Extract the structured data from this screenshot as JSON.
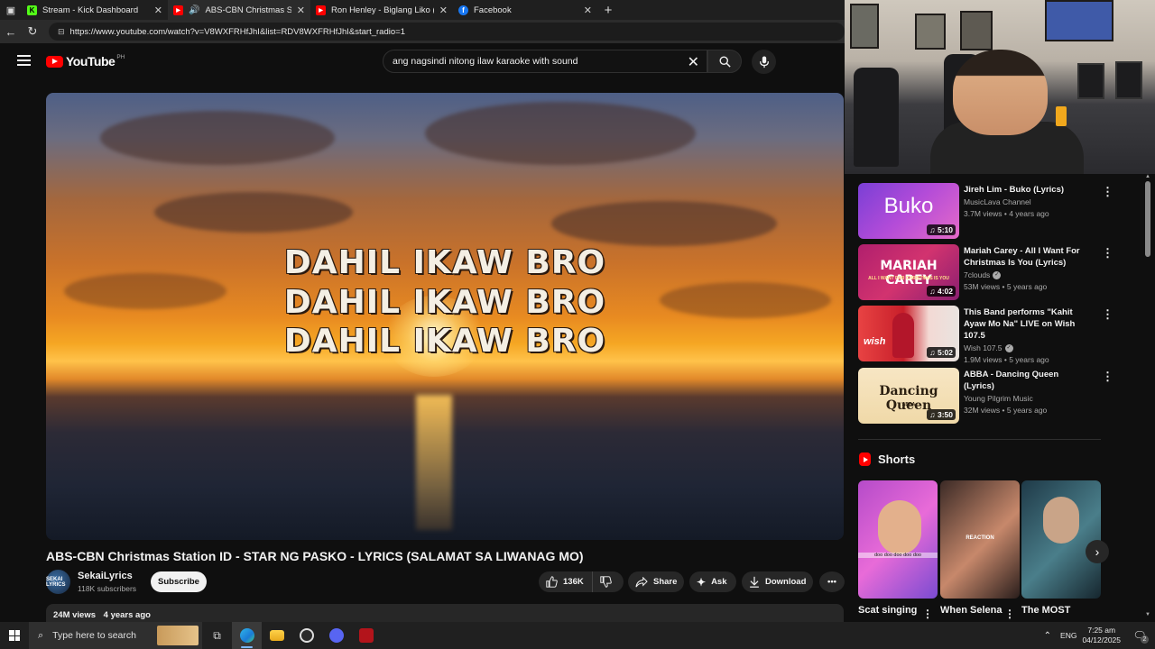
{
  "browser": {
    "tabs": [
      {
        "title": "Stream - Kick Dashboard",
        "favicon": "kick-icon",
        "color": "#53fc18"
      },
      {
        "title": "ABS-CBN Christmas Station I",
        "favicon": "youtube-icon",
        "color": "#ff0000",
        "audio": true
      },
      {
        "title": "Ron Henley - Biglang Liko (Lyrics)",
        "favicon": "youtube-icon",
        "color": "#ff0000"
      },
      {
        "title": "Facebook",
        "favicon": "facebook-icon",
        "color": "#1877f2"
      }
    ],
    "new_tab": "+",
    "url": "https://www.youtube.com/watch?v=V8WXFRHfJhI&list=RDV8WXFRHfJhI&start_radio=1"
  },
  "youtube": {
    "logo_text": "YouTube",
    "country_code": "PH",
    "search_query": "ang nagsindi nitong ilaw karaoke with sound"
  },
  "video": {
    "lyric_lines": [
      "DAHIL IKAW BRO",
      "DAHIL IKAW BRO",
      "DAHIL IKAW BRO"
    ],
    "title": "ABS-CBN Christmas Station ID - STAR NG PASKO - LYRICS (SALAMAT SA LIWANAG MO)",
    "channel": "SekaiLyrics",
    "subscribers": "118K subscribers",
    "avatar_text": "SEKAI LYRICS",
    "subscribe_label": "Subscribe",
    "likes": "136K",
    "share_label": "Share",
    "ask_label": "Ask",
    "download_label": "Download",
    "views": "24M views",
    "age": "4 years ago"
  },
  "related": [
    {
      "title": "Jireh Lim - Buko (Lyrics)",
      "channel": "MusicLava Channel",
      "views": "3.7M views",
      "age": "4 years ago",
      "duration": "5:10",
      "thumb_text": "Buko",
      "verified": false
    },
    {
      "title": "Mariah Carey - All I Want For Christmas Is You (Lyrics)",
      "channel": "7clouds",
      "views": "53M views",
      "age": "5 years ago",
      "duration": "4:02",
      "thumb_text": "MARIAH CAREY",
      "thumb_sub": "ALL I WANT FOR CHRISTMAS IS YOU",
      "verified": true
    },
    {
      "title": "This Band performs \"Kahit Ayaw Mo Na\" LIVE on Wish 107.5",
      "channel": "Wish 107.5",
      "views": "1.9M views",
      "age": "5 years ago",
      "duration": "5:02",
      "thumb_text": "wish",
      "verified": true
    },
    {
      "title": "ABBA - Dancing Queen (Lyrics)",
      "channel": "Young Pilgrim Music",
      "views": "32M views",
      "age": "5 years ago",
      "duration": "3:50",
      "thumb_text": "Dancing Queen",
      "thumb_sub": "ABBA",
      "verified": false
    }
  ],
  "shorts": {
    "header": "Shorts",
    "items": [
      {
        "title": "Scat singing with the",
        "overlay": "doo doo doo doo doo"
      },
      {
        "title": "When Selena had to",
        "overlay": "REACTION"
      },
      {
        "title": "The MOST Suspicious",
        "overlay": ""
      }
    ]
  },
  "taskbar": {
    "search_placeholder": "Type here to search",
    "language": "ENG",
    "time": "7:25 am",
    "date": "04/12/2025",
    "notification_count": "2"
  }
}
